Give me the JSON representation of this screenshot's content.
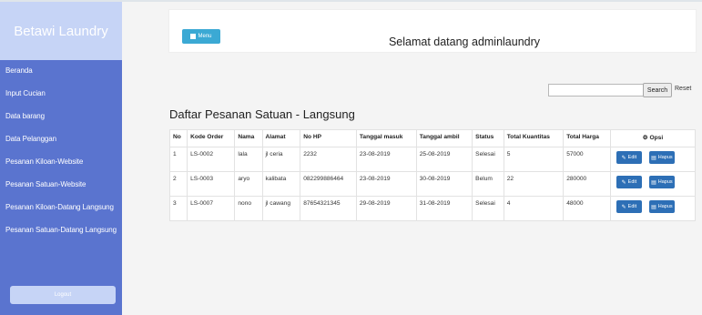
{
  "sidebar": {
    "brand": "Betawi Laundry",
    "items": [
      {
        "label": "Beranda"
      },
      {
        "label": "Input Cucian"
      },
      {
        "label": "Data barang"
      },
      {
        "label": "Data Pelanggan"
      },
      {
        "label": "Pesanan Kiloan-Website"
      },
      {
        "label": "Pesanan Satuan-Website"
      },
      {
        "label": "Pesanan Kiloan-Datang Langsung"
      },
      {
        "label": "Pesanan Satuan-Datang Langsung"
      }
    ],
    "logout_label": "Logout"
  },
  "header": {
    "menu_label": "Menu",
    "welcome": "Selamat datang adminlaundry"
  },
  "search": {
    "value": "",
    "button_label": "Search",
    "reset_label": "Reset"
  },
  "page_title": "Daftar Pesanan Satuan - Langsung",
  "table": {
    "columns": [
      "No",
      "Kode Order",
      "Nama",
      "Alamat",
      "No HP",
      "Tanggal masuk",
      "Tanggal ambil",
      "Status",
      "Total Kuantitas",
      "Total Harga",
      "Opsi"
    ],
    "rows": [
      [
        "1",
        "LS-0002",
        "lala",
        "jl ceria",
        "2232",
        "23-08-2019",
        "25-08-2019",
        "Selesai",
        "5",
        "57000"
      ],
      [
        "2",
        "LS-0003",
        "aryo",
        "kalibata",
        "082299886464",
        "23-08-2019",
        "30-08-2019",
        "Belum",
        "22",
        "280000"
      ],
      [
        "3",
        "LS-0007",
        "nono",
        "jl cawang",
        "87654321345",
        "29-08-2019",
        "31-08-2019",
        "Selesai",
        "4",
        "48000"
      ]
    ],
    "edit_label": "Edit",
    "delete_label": "Hapus"
  },
  "colors": {
    "sidebar": "#5a74cf",
    "brand_bg": "#c6d4f6",
    "menu_button": "#3ba9d4",
    "action_button": "#2d6fb6"
  },
  "icons": {
    "menu": "list-icon",
    "opsi": "gear-icon",
    "edit": "pencil-icon",
    "delete": "document-icon"
  }
}
